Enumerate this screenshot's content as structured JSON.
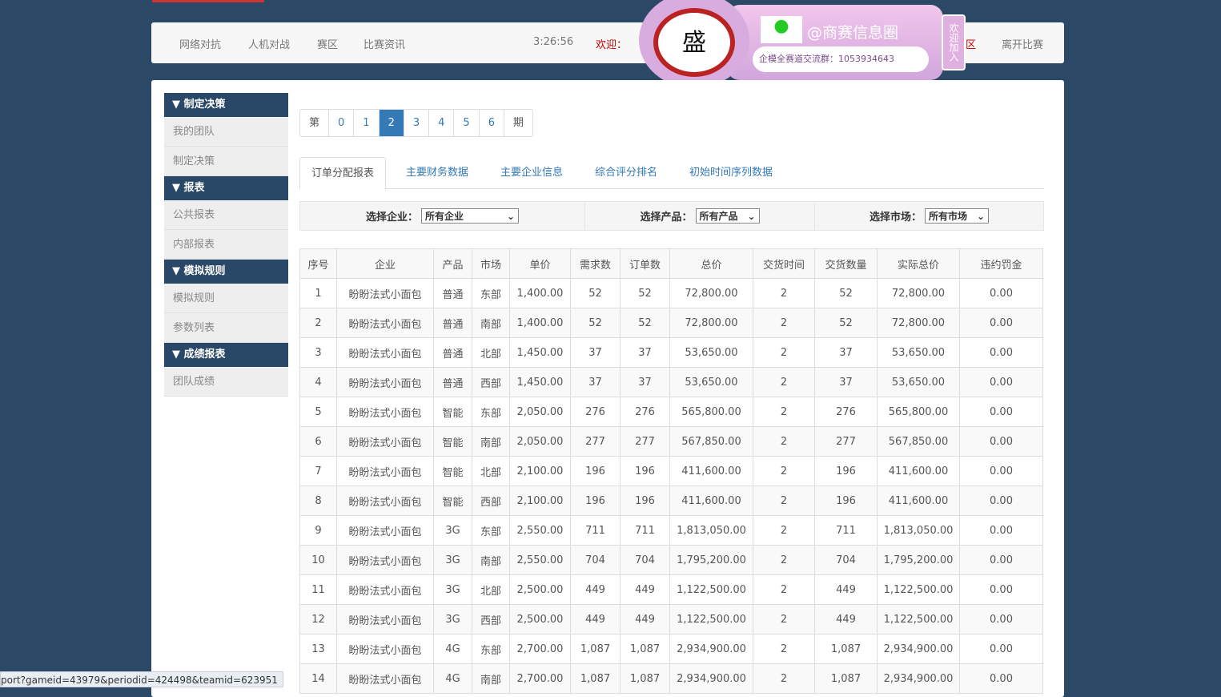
{
  "nav": {
    "items": [
      "网络对抗",
      "人机对战",
      "赛区",
      "比赛资讯"
    ],
    "time": "3:26:56",
    "welcome": "欢迎：",
    "zone_tail": "区",
    "leave": "离开比赛"
  },
  "promo": {
    "title": "@商赛信息圈",
    "group": "企模全赛道交流群：1053934643",
    "join": "欢迎加入",
    "accent": "#e0b6e8"
  },
  "sidebar": [
    {
      "header": "▼ 制定决策",
      "items": [
        "我的团队",
        "制定决策"
      ]
    },
    {
      "header": "▼ 报表",
      "items": [
        "公共报表",
        "内部报表"
      ]
    },
    {
      "header": "▼ 模拟规则",
      "items": [
        "模拟规则",
        "参数列表"
      ]
    },
    {
      "header": "▼ 成绩报表",
      "items": [
        "团队成绩"
      ]
    }
  ],
  "pager": {
    "prefix": "第",
    "pages": [
      "0",
      "1",
      "2",
      "3",
      "4",
      "5",
      "6"
    ],
    "active": "2",
    "suffix": "期"
  },
  "tabs": [
    "订单分配报表",
    "主要财务数据",
    "主要企业信息",
    "综合评分排名",
    "初始时间序列数据"
  ],
  "filters": [
    {
      "label": "选择企业：",
      "value": "所有企业"
    },
    {
      "label": "选择产品：",
      "value": "所有产品"
    },
    {
      "label": "选择市场：",
      "value": "所有市场"
    }
  ],
  "table": {
    "headers": [
      "序号",
      "企业",
      "产品",
      "市场",
      "单价",
      "需求数",
      "订单数",
      "总价",
      "交货时间",
      "交货数量",
      "实际总价",
      "违约罚金"
    ],
    "rows": [
      [
        "1",
        "盼盼法式小面包",
        "普通",
        "东部",
        "1,400.00",
        "52",
        "52",
        "72,800.00",
        "2",
        "52",
        "72,800.00",
        "0.00"
      ],
      [
        "2",
        "盼盼法式小面包",
        "普通",
        "南部",
        "1,400.00",
        "52",
        "52",
        "72,800.00",
        "2",
        "52",
        "72,800.00",
        "0.00"
      ],
      [
        "3",
        "盼盼法式小面包",
        "普通",
        "北部",
        "1,450.00",
        "37",
        "37",
        "53,650.00",
        "2",
        "37",
        "53,650.00",
        "0.00"
      ],
      [
        "4",
        "盼盼法式小面包",
        "普通",
        "西部",
        "1,450.00",
        "37",
        "37",
        "53,650.00",
        "2",
        "37",
        "53,650.00",
        "0.00"
      ],
      [
        "5",
        "盼盼法式小面包",
        "智能",
        "东部",
        "2,050.00",
        "276",
        "276",
        "565,800.00",
        "2",
        "276",
        "565,800.00",
        "0.00"
      ],
      [
        "6",
        "盼盼法式小面包",
        "智能",
        "南部",
        "2,050.00",
        "277",
        "277",
        "567,850.00",
        "2",
        "277",
        "567,850.00",
        "0.00"
      ],
      [
        "7",
        "盼盼法式小面包",
        "智能",
        "北部",
        "2,100.00",
        "196",
        "196",
        "411,600.00",
        "2",
        "196",
        "411,600.00",
        "0.00"
      ],
      [
        "8",
        "盼盼法式小面包",
        "智能",
        "西部",
        "2,100.00",
        "196",
        "196",
        "411,600.00",
        "2",
        "196",
        "411,600.00",
        "0.00"
      ],
      [
        "9",
        "盼盼法式小面包",
        "3G",
        "东部",
        "2,550.00",
        "711",
        "711",
        "1,813,050.00",
        "2",
        "711",
        "1,813,050.00",
        "0.00"
      ],
      [
        "10",
        "盼盼法式小面包",
        "3G",
        "南部",
        "2,550.00",
        "704",
        "704",
        "1,795,200.00",
        "2",
        "704",
        "1,795,200.00",
        "0.00"
      ],
      [
        "11",
        "盼盼法式小面包",
        "3G",
        "北部",
        "2,500.00",
        "449",
        "449",
        "1,122,500.00",
        "2",
        "449",
        "1,122,500.00",
        "0.00"
      ],
      [
        "12",
        "盼盼法式小面包",
        "3G",
        "西部",
        "2,500.00",
        "449",
        "449",
        "1,122,500.00",
        "2",
        "449",
        "1,122,500.00",
        "0.00"
      ],
      [
        "13",
        "盼盼法式小面包",
        "4G",
        "东部",
        "2,700.00",
        "1,087",
        "1,087",
        "2,934,900.00",
        "2",
        "1,087",
        "2,934,900.00",
        "0.00"
      ],
      [
        "14",
        "盼盼法式小面包",
        "4G",
        "南部",
        "2,700.00",
        "1,087",
        "1,087",
        "2,934,900.00",
        "2",
        "1,087",
        "2,934,900.00",
        "0.00"
      ]
    ]
  },
  "status_url": "port?gameid=43979&periodid=424498&teamid=623951"
}
